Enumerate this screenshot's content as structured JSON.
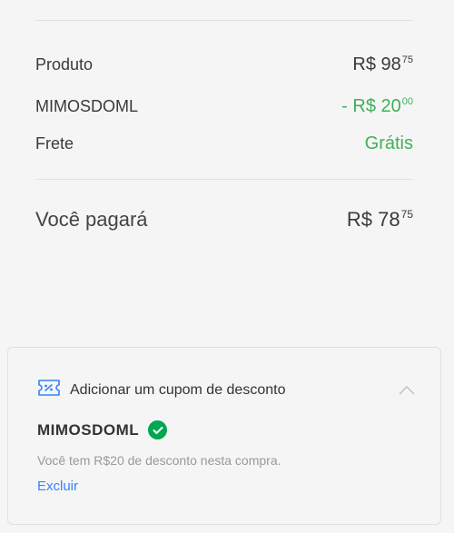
{
  "summary": {
    "product": {
      "label": "Produto",
      "currency": "R$ ",
      "amount": "98",
      "cents": "75"
    },
    "discount": {
      "label": "MIMOSDOML",
      "prefix": "- ",
      "currency": "R$ ",
      "amount": "20",
      "cents": "00"
    },
    "shipping": {
      "label": "Frete",
      "value": "Grátis"
    },
    "total": {
      "label": "Você pagará",
      "currency": "R$ ",
      "amount": "78",
      "cents": "75"
    }
  },
  "coupon": {
    "icon": "coupon-ticket-icon",
    "title": "Adicionar um cupom de desconto",
    "code": "MIMOSDOML",
    "message": "Você tem R$20 de desconto nesta compra.",
    "remove_label": "Excluir",
    "expanded": true
  },
  "colors": {
    "green_value": "#3fb05b",
    "success_badge": "#00a650",
    "link": "#3483fa",
    "coupon_icon": "#3483fa"
  }
}
